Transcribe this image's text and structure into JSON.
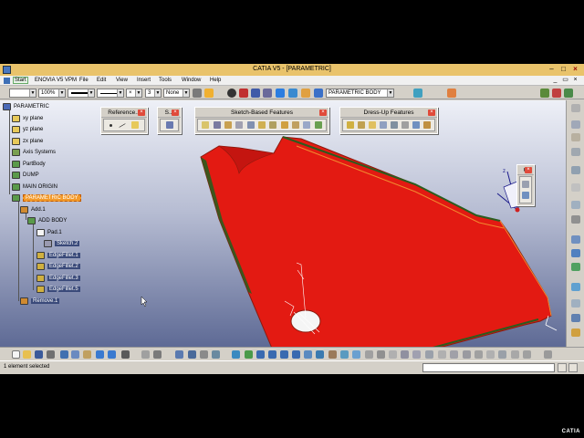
{
  "window": {
    "title": "CATIA V5 - [PARAMETRIC]",
    "controls": {
      "minimize": "‒",
      "maximize": "□",
      "close": "×"
    }
  },
  "menu": {
    "items": [
      "Start",
      "ENOVIA V5 VPM",
      "File",
      "Edit",
      "View",
      "Insert",
      "Tools",
      "Window",
      "Help"
    ],
    "mdi": {
      "minimize": "_",
      "restore": "▭",
      "close": "×"
    }
  },
  "toolbar": {
    "zoom_value": "100%",
    "line_weight_value": "3",
    "layer_value": "None",
    "current_body": "PARAMETRIC BODY"
  },
  "tree": {
    "root": "PARAMETRIC",
    "nodes": {
      "xy": "xy plane",
      "yz": "yz plane",
      "zx": "zx plane",
      "axis": "Axis Systems",
      "partbody": "PartBody",
      "dump": "DUMP",
      "main_origin": "MAIN ORIGIN",
      "parametric_body": "PARAMETRIC BODY",
      "add1": "Add.1",
      "add_body": "ADD BODY",
      "pad1": "Pad.1",
      "sketch2": "Sketch.2",
      "fillet1": "EdgeFillet.1",
      "fillet2": "EdgeFillet.2",
      "fillet3": "EdgeFillet.3",
      "fillet5": "EdgeFillet.5",
      "remove1": "Remove.1"
    }
  },
  "floating_toolbars": {
    "reference": {
      "title": "Reference...",
      "close": "×"
    },
    "s": {
      "title": "S...",
      "close": "×"
    },
    "sketch_based": {
      "title": "Sketch-Based Features",
      "close": "×"
    },
    "dress_up": {
      "title": "Dress-Up Features",
      "close": "×"
    },
    "c": {
      "title": "C",
      "close": "×"
    }
  },
  "status": {
    "message": "1 element selected"
  },
  "watermark": "CATIA",
  "colors": {
    "part_red": "#e31a12",
    "part_edge": "#2b5c1e",
    "selection_orange": "#f39a2b",
    "titlebar": "#e9c36b"
  }
}
